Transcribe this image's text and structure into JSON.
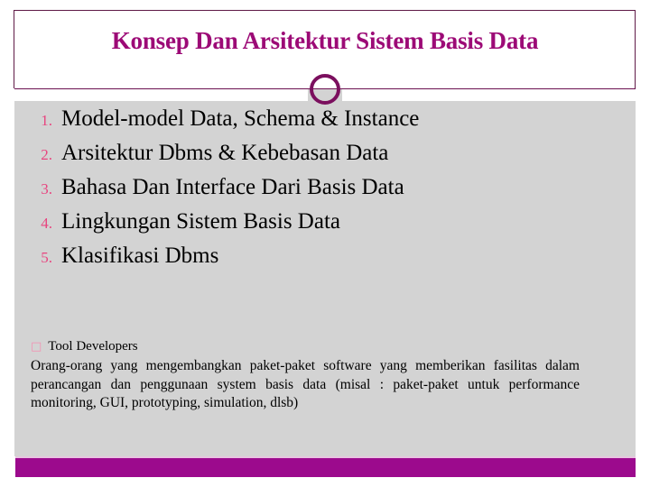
{
  "slide": {
    "title": "Konsep Dan Arsitektur Sistem Basis Data",
    "ornament_icon": "circle-ring-ornament",
    "divider_icon": "horizontal-divider"
  },
  "topics": [
    {
      "number": "1.",
      "text": "Model-model Data, Schema & Instance"
    },
    {
      "number": "2.",
      "text": "Arsitektur Dbms & Kebebasan Data"
    },
    {
      "number": "3.",
      "text": "Bahasa Dan Interface Dari Basis Data"
    },
    {
      "number": "4.",
      "text": "Lingkungan Sistem Basis Data"
    },
    {
      "number": "5.",
      "text": "Klasifikasi Dbms"
    }
  ],
  "tool_developers": {
    "bullet_glyph": "□",
    "bullet_icon": "hollow-square-bullet",
    "label": "Tool Developers",
    "paragraph": "Orang-orang yang mengembangkan paket-paket software yang memberikan fasilitas dalam perancangan dan penggunaan system basis data (misal : paket-paket untuk performance monitoring, GUI, prototyping, simulation, dlsb)"
  },
  "colors": {
    "title_purple": "#9c0a76",
    "ring_purple": "#7b0f5e",
    "number_pink": "#e8447f",
    "bullet_pink": "#f48fb1",
    "body_gray": "#d3d3d3",
    "footer_magenta": "#9c0a8d"
  }
}
